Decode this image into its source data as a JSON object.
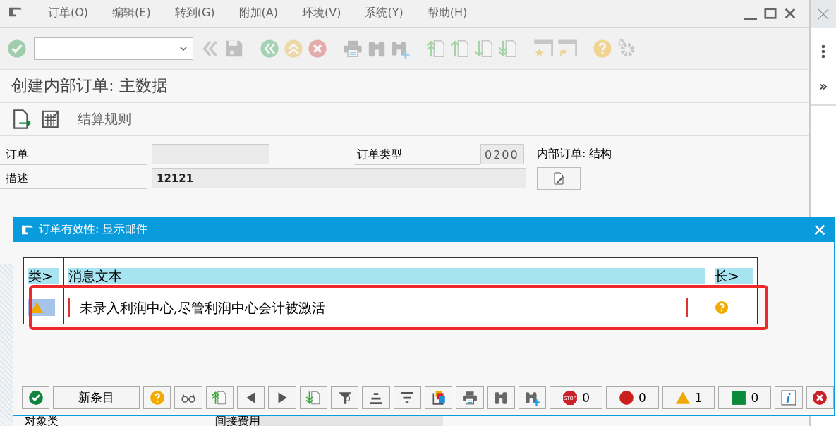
{
  "menu": [
    {
      "label": "订单(O)"
    },
    {
      "label": "编辑(E)"
    },
    {
      "label": "转到(G)"
    },
    {
      "label": "附加(A)"
    },
    {
      "label": "环境(V)"
    },
    {
      "label": "系统(Y)"
    },
    {
      "label": "帮助(H)"
    }
  ],
  "toolbar": [
    {
      "kind": "check",
      "disabled": true
    },
    {
      "kind": "command"
    },
    {
      "kind": "back",
      "disabled": true
    },
    {
      "kind": "save",
      "disabled": true
    },
    {
      "kind": "gap"
    },
    {
      "kind": "exit",
      "disabled": true
    },
    {
      "kind": "up",
      "disabled": true
    },
    {
      "kind": "cancel",
      "disabled": true
    },
    {
      "kind": "gap"
    },
    {
      "kind": "print",
      "disabled": true
    },
    {
      "kind": "find",
      "disabled": true
    },
    {
      "kind": "findmore",
      "disabled": true
    },
    {
      "kind": "gap"
    },
    {
      "kind": "first",
      "disabled": true
    },
    {
      "kind": "prevpage",
      "disabled": true
    },
    {
      "kind": "nextpage",
      "disabled": true
    },
    {
      "kind": "last",
      "disabled": true
    },
    {
      "kind": "gap"
    },
    {
      "kind": "bookmark",
      "disabled": true
    },
    {
      "kind": "shortcut",
      "disabled": true
    },
    {
      "kind": "gap"
    },
    {
      "kind": "help",
      "disabled": true
    },
    {
      "kind": "settings",
      "disabled": true
    }
  ],
  "page_title": "创建内部订单: 主数据",
  "app_toolbar": [
    {
      "kind": "export"
    },
    {
      "kind": "table-edit"
    },
    {
      "kind": "text",
      "label": "结算规则"
    }
  ],
  "form": [
    {
      "label": "订单",
      "field2_label": "订单类型",
      "field2_value": "0200",
      "note": "内部订单: 结构"
    },
    {
      "label": "描述",
      "value": "12121"
    }
  ],
  "lower": {
    "label": "对象类",
    "value": "间接费用"
  },
  "dialog": {
    "title": "订单有效性: 显示邮件",
    "columns": [
      "类>",
      "消息文本",
      "长>"
    ],
    "rows": [
      {
        "kind": "warning",
        "text": "未录入利润中心,尽管利润中心会计被激活"
      }
    ],
    "highlighted": true,
    "buttons": [
      {
        "kind": "ok"
      },
      {
        "kind": "text",
        "label": "新条目"
      },
      {
        "kind": "help"
      },
      {
        "kind": "glasses"
      },
      {
        "kind": "first"
      },
      {
        "kind": "prev"
      },
      {
        "kind": "next"
      },
      {
        "kind": "last"
      },
      {
        "kind": "filter"
      },
      {
        "kind": "sum"
      },
      {
        "kind": "sort"
      },
      {
        "kind": "copy"
      },
      {
        "kind": "print"
      },
      {
        "kind": "find"
      },
      {
        "kind": "findmore"
      },
      {
        "kind": "stop",
        "count": "0",
        "icon_text": "STOP"
      },
      {
        "kind": "error",
        "count": "0"
      },
      {
        "kind": "warning",
        "count": "1"
      },
      {
        "kind": "success",
        "count": "0"
      },
      {
        "kind": "info"
      },
      {
        "kind": "close"
      }
    ]
  }
}
